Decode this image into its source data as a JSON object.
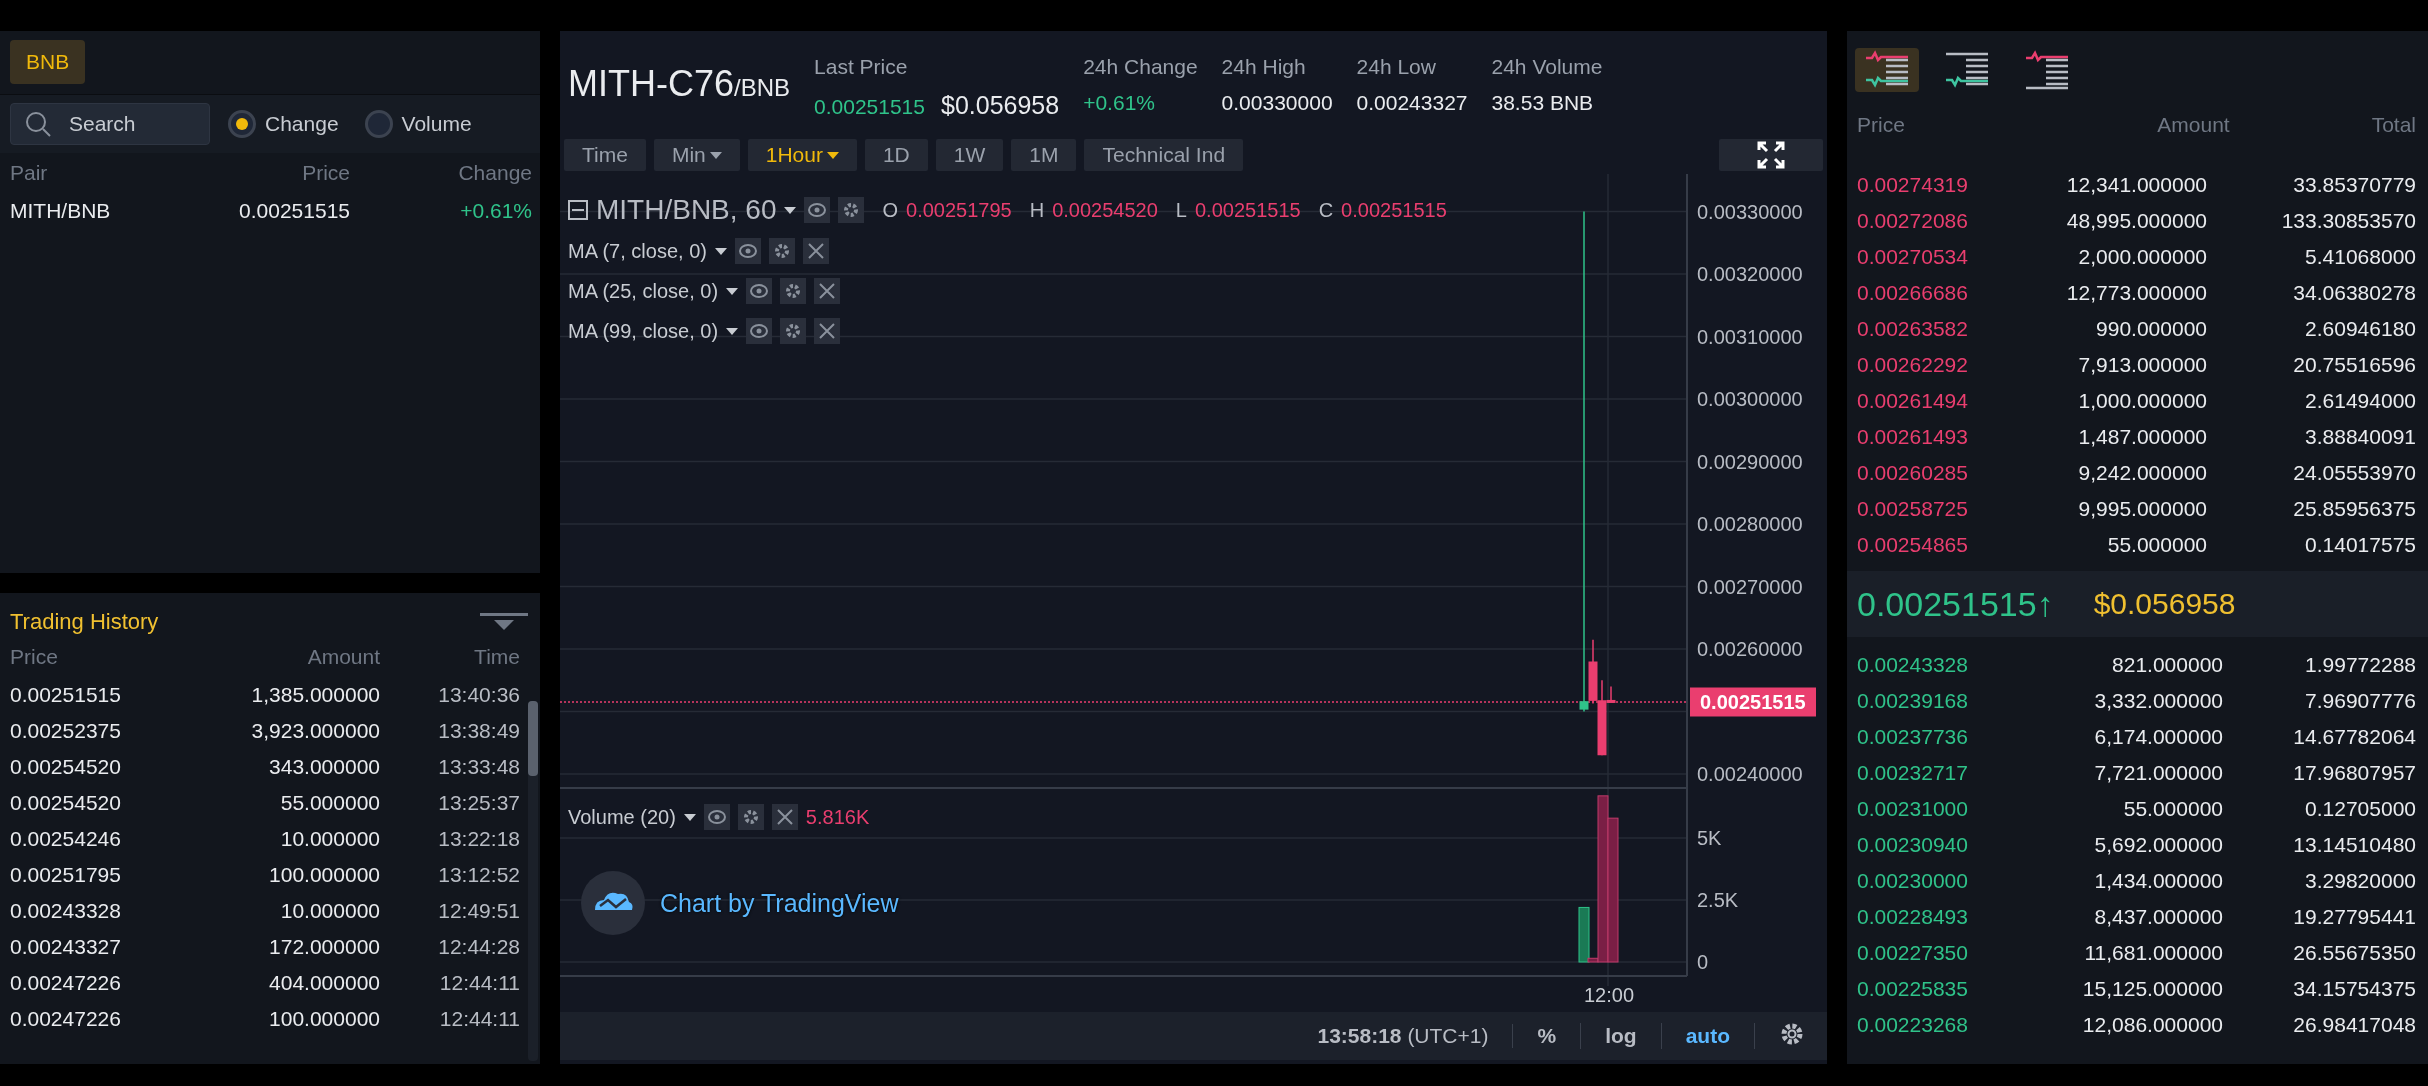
{
  "markets": {
    "tabs": [
      {
        "label": "BNB",
        "selected": true
      }
    ],
    "search": {
      "placeholder": "Search"
    },
    "sort_options": [
      {
        "label": "Change",
        "selected": true
      },
      {
        "label": "Volume",
        "selected": false
      }
    ],
    "columns": [
      "Pair",
      "Price",
      "Change"
    ],
    "rows": [
      {
        "pair": "MITH/BNB",
        "price": "0.00251515",
        "change": "+0.61%",
        "rising": true
      }
    ]
  },
  "trading_history": {
    "title": "Trading History",
    "columns": [
      "Price",
      "Amount",
      "Time"
    ],
    "rows": [
      {
        "price": "0.00251515",
        "amount": "1,385.000000",
        "time": "13:40:36"
      },
      {
        "price": "0.00252375",
        "amount": "3,923.000000",
        "time": "13:38:49"
      },
      {
        "price": "0.00254520",
        "amount": "343.000000",
        "time": "13:33:48"
      },
      {
        "price": "0.00254520",
        "amount": "55.000000",
        "time": "13:25:37"
      },
      {
        "price": "0.00254246",
        "amount": "10.000000",
        "time": "13:22:18"
      },
      {
        "price": "0.00251795",
        "amount": "100.000000",
        "time": "13:12:52"
      },
      {
        "price": "0.00243328",
        "amount": "10.000000",
        "time": "12:49:51"
      },
      {
        "price": "0.00243327",
        "amount": "172.000000",
        "time": "12:44:28"
      },
      {
        "price": "0.00247226",
        "amount": "404.000000",
        "time": "12:44:11"
      },
      {
        "price": "0.00247226",
        "amount": "100.000000",
        "time": "12:44:11"
      }
    ]
  },
  "ticker": {
    "symbol": "MITH-C76",
    "quote": "/BNB",
    "stats": [
      {
        "label": "Last Price",
        "value": "0.00251515",
        "rising": true,
        "usd": "$0.056958"
      },
      {
        "label": "24h Change",
        "value": "+0.61%",
        "rising": true
      },
      {
        "label": "24h High",
        "value": "0.00330000",
        "rising": false
      },
      {
        "label": "24h Low",
        "value": "0.00243327",
        "rising": false
      },
      {
        "label": "24h Volume",
        "value": "38.53 BNB",
        "rising": false
      }
    ]
  },
  "toolbar": [
    {
      "label": "Time",
      "kind": "button",
      "selected": false
    },
    {
      "label": "Min",
      "kind": "dropdown",
      "selected": false
    },
    {
      "label": "1Hour",
      "kind": "dropdown",
      "selected": true
    },
    {
      "label": "1D",
      "kind": "button",
      "selected": false
    },
    {
      "label": "1W",
      "kind": "button",
      "selected": false
    },
    {
      "label": "1M",
      "kind": "button",
      "selected": false
    },
    {
      "label": "Technical Ind",
      "kind": "button",
      "selected": false
    }
  ],
  "chart": {
    "symbol": "MITH/BNB, 60",
    "ohlc": [
      {
        "key": "O",
        "value": "0.00251795"
      },
      {
        "key": "H",
        "value": "0.00254520"
      },
      {
        "key": "L",
        "value": "0.00251515"
      },
      {
        "key": "C",
        "value": "0.00251515"
      }
    ],
    "indicators": [
      {
        "label": "MA (7, close, 0)"
      },
      {
        "label": "MA (25, close, 0)"
      },
      {
        "label": "MA (99, close, 0)"
      }
    ],
    "price_ticks": [
      "0.00330000",
      "0.00320000",
      "0.00310000",
      "0.00300000",
      "0.00290000",
      "0.00280000",
      "0.00270000",
      "0.00260000",
      "0.00240000"
    ],
    "current_price": "0.00251515",
    "volume": {
      "label": "Volume (20)",
      "value": "5.816K",
      "ticks": [
        "5K",
        "2.5K",
        "0"
      ]
    },
    "time_ticks": [
      "12:00"
    ],
    "attribution": "Chart by TradingView"
  },
  "status_bar": {
    "time": "13:58:18",
    "zone": "(UTC+1)",
    "toggles": [
      {
        "label": "%",
        "selected": false
      },
      {
        "label": "log",
        "selected": false
      },
      {
        "label": "auto",
        "selected": true
      }
    ]
  },
  "order_book": {
    "view_modes": [
      {
        "kind": "both",
        "selected": true
      },
      {
        "kind": "bids",
        "selected": false
      },
      {
        "kind": "asks",
        "selected": false
      }
    ],
    "columns": [
      "Price",
      "Amount",
      "Total"
    ],
    "asks": [
      {
        "price": "0.00274319",
        "amount": "12,341.000000",
        "total": "33.85370779"
      },
      {
        "price": "0.00272086",
        "amount": "48,995.000000",
        "total": "133.30853570"
      },
      {
        "price": "0.00270534",
        "amount": "2,000.000000",
        "total": "5.41068000"
      },
      {
        "price": "0.00266686",
        "amount": "12,773.000000",
        "total": "34.06380278"
      },
      {
        "price": "0.00263582",
        "amount": "990.000000",
        "total": "2.60946180"
      },
      {
        "price": "0.00262292",
        "amount": "7,913.000000",
        "total": "20.75516596"
      },
      {
        "price": "0.00261494",
        "amount": "1,000.000000",
        "total": "2.61494000"
      },
      {
        "price": "0.00261493",
        "amount": "1,487.000000",
        "total": "3.88840091"
      },
      {
        "price": "0.00260285",
        "amount": "9,242.000000",
        "total": "24.05553970"
      },
      {
        "price": "0.00258725",
        "amount": "9,995.000000",
        "total": "25.85956375"
      },
      {
        "price": "0.00254865",
        "amount": "55.000000",
        "total": "0.14017575"
      }
    ],
    "last_price": {
      "price": "0.00251515",
      "arrow": "↑",
      "usd": "$0.056958",
      "rising": true
    },
    "bids": [
      {
        "price": "0.00243328",
        "amount": "821.000000",
        "total": "1.99772288"
      },
      {
        "price": "0.00239168",
        "amount": "3,332.000000",
        "total": "7.96907776"
      },
      {
        "price": "0.00237736",
        "amount": "6,174.000000",
        "total": "14.67782064"
      },
      {
        "price": "0.00232717",
        "amount": "7,721.000000",
        "total": "17.96807957"
      },
      {
        "price": "0.00231000",
        "amount": "55.000000",
        "total": "0.12705000"
      },
      {
        "price": "0.00230940",
        "amount": "5,692.000000",
        "total": "13.14510480"
      },
      {
        "price": "0.00230000",
        "amount": "1,434.000000",
        "total": "3.29820000"
      },
      {
        "price": "0.00228493",
        "amount": "8,437.000000",
        "total": "19.27795441"
      },
      {
        "price": "0.00227350",
        "amount": "11,681.000000",
        "total": "26.55675350"
      },
      {
        "price": "0.00225835",
        "amount": "15,125.000000",
        "total": "34.15754375"
      },
      {
        "price": "0.00223268",
        "amount": "12,086.000000",
        "total": "26.98417048"
      }
    ]
  }
}
